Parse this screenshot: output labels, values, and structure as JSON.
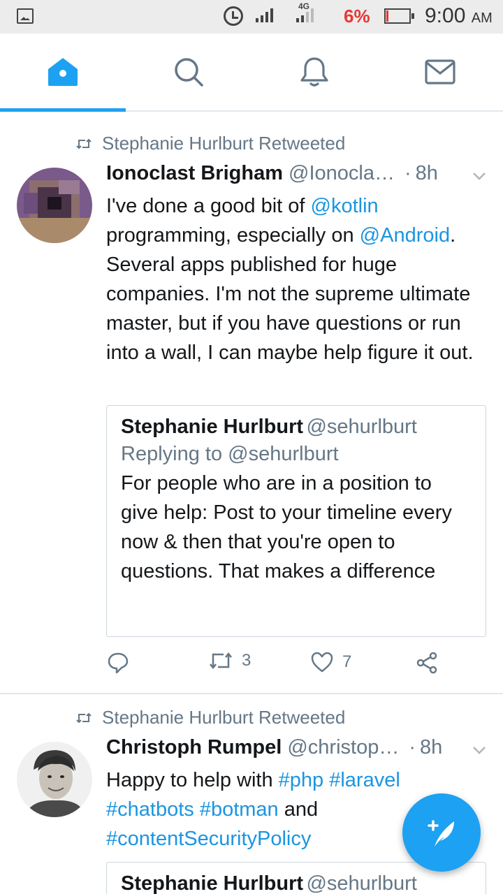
{
  "status_bar": {
    "network": "4G",
    "battery_percent": "6%",
    "time": "9:00",
    "ampm": "AM",
    "battery_level": 0.06
  },
  "tabs": [
    {
      "name": "home",
      "icon": "home-icon",
      "active": true
    },
    {
      "name": "search",
      "icon": "search-icon",
      "active": false
    },
    {
      "name": "notifications",
      "icon": "bell-icon",
      "active": false
    },
    {
      "name": "messages",
      "icon": "mail-icon",
      "active": false
    }
  ],
  "tweets": [
    {
      "retweeted_by": "Stephanie Hurlburt Retweeted",
      "name": "Ionoclast Brigham",
      "handle": "@Ionocla…",
      "dot": "·",
      "time": "8h",
      "text_parts": {
        "p1": "I've done a good bit of ",
        "link1": "@kotlin",
        "p2": " programming, especially on ",
        "link2": "@Android",
        "p3": ". Several apps published for huge companies. I'm not the supreme ultimate master, but if you have questions or run into a wall, I can maybe help figure it out."
      },
      "quote": {
        "name": "Stephanie Hurlburt",
        "handle": "@sehurlburt",
        "replying_to": "Replying to @sehurlburt",
        "text": "For people who are in a position to give help: Post to your timeline every now & then that you're open to questions. That makes a difference"
      },
      "retweets": "3",
      "likes": "7"
    },
    {
      "retweeted_by": "Stephanie Hurlburt Retweeted",
      "name": "Christoph Rumpel",
      "handle": "@christop…",
      "dot": "·",
      "time": "8h",
      "text_parts": {
        "p1": "Happy to help with ",
        "tag1": "#php",
        "sp1": " ",
        "tag2": "#laravel",
        "sp2": " ",
        "tag3": "#chatbots",
        "sp3": " ",
        "tag4": "#botman",
        "p2": " and ",
        "tag5": "#contentSecurityPolicy"
      },
      "quote": {
        "name": "Stephanie Hurlburt",
        "handle": "@sehurlburt"
      }
    }
  ],
  "colors": {
    "accent": "#1da1f2",
    "link": "#1b95e0",
    "secondary_text": "#657786",
    "battery_low": "#e53935"
  }
}
